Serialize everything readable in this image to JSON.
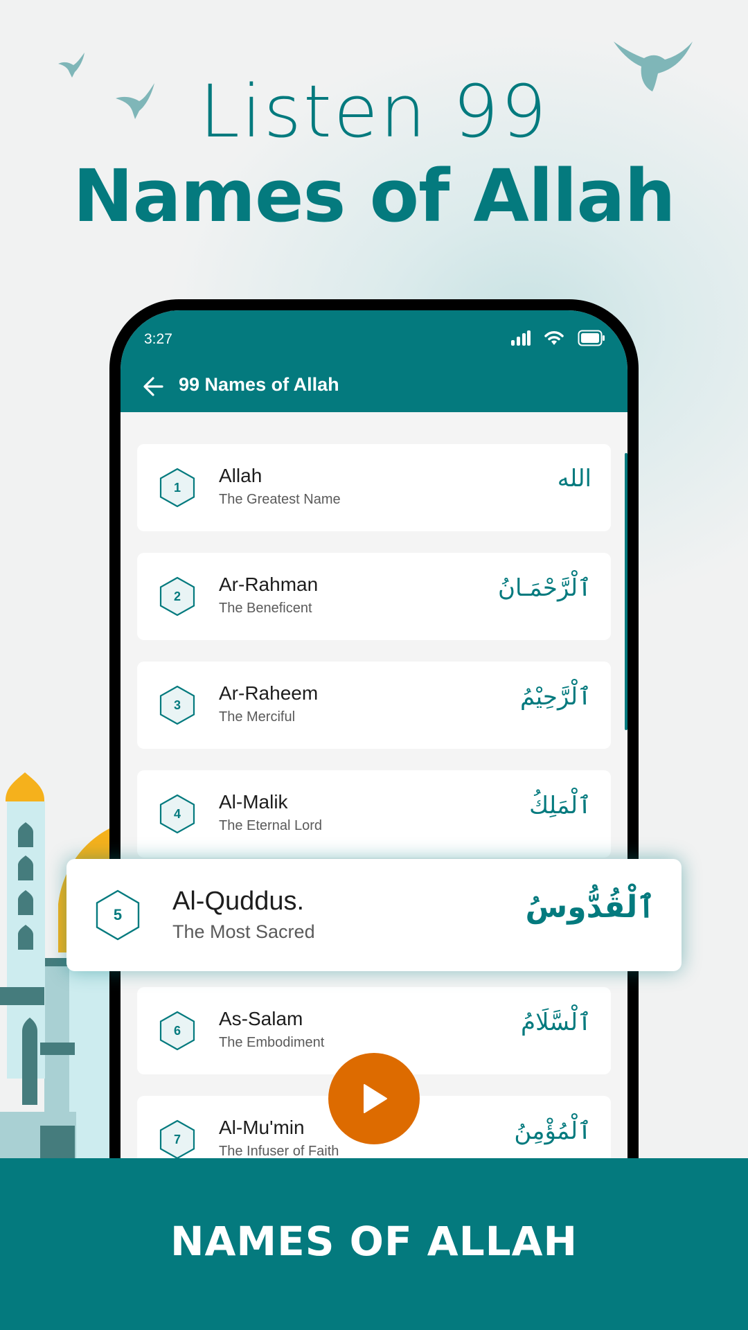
{
  "headline": {
    "line1": "Listen 99",
    "line2": "Names of Allah"
  },
  "colors": {
    "brand": "#047a7e",
    "accent": "#dd6b00",
    "dome": "#f5b11c"
  },
  "phone": {
    "status_bar": {
      "time": "3:27",
      "icons": [
        "signal-icon",
        "wifi-icon",
        "battery-icon"
      ]
    },
    "app_bar": {
      "back_icon": "arrow-left-icon",
      "title": "99 Names of Allah"
    },
    "names": [
      {
        "number": "1",
        "name": "Allah",
        "meaning": "The Greatest Name",
        "arabic": "الله"
      },
      {
        "number": "2",
        "name": "Ar-Rahman",
        "meaning": "The Beneficent",
        "arabic": "ٱلْرَّحْمَـانُ"
      },
      {
        "number": "3",
        "name": "Ar-Raheem",
        "meaning": "The Merciful",
        "arabic": "ٱلْرَّحِيْمُ"
      },
      {
        "number": "4",
        "name": "Al-Malik",
        "meaning": "The Eternal Lord",
        "arabic": "ٱلْمَلِكُ"
      },
      {
        "number": "6",
        "name": "As-Salam",
        "meaning": "The Embodiment",
        "arabic": "ٱلْسَّلَامُ"
      },
      {
        "number": "7",
        "name": "Al-Mu'min",
        "meaning": "The Infuser of Faith",
        "arabic": "ٱلْمُؤْمِنُ"
      }
    ],
    "play_icon": "play-icon"
  },
  "featured": {
    "number": "5",
    "name": "Al-Quddus.",
    "meaning": "The Most Sacred",
    "arabic": "ٱلْقُدُّوسُ"
  },
  "footer": {
    "text": "NAMES OF ALLAH"
  }
}
